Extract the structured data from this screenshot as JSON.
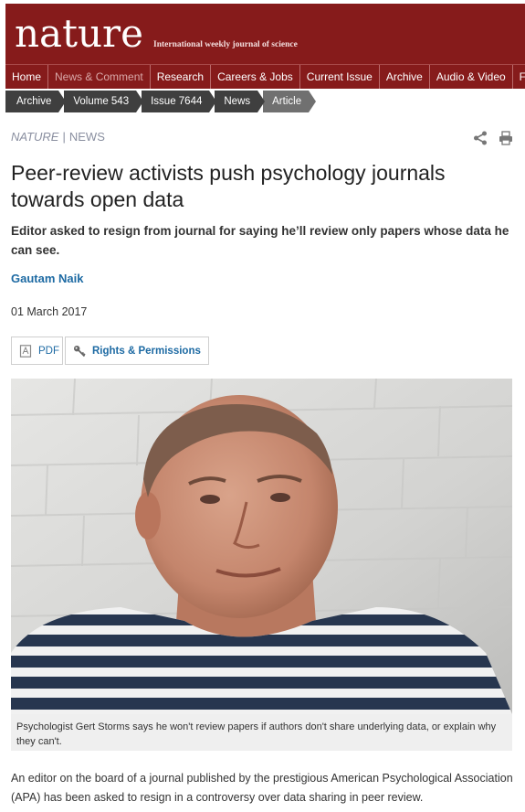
{
  "masthead": {
    "logo": "nature",
    "tagline": "International weekly journal of science"
  },
  "main_nav": {
    "items": [
      {
        "label": "Home",
        "active": false
      },
      {
        "label": "News & Comment",
        "active": true
      },
      {
        "label": "Research",
        "active": false
      },
      {
        "label": "Careers & Jobs",
        "active": false
      },
      {
        "label": "Current Issue",
        "active": false
      },
      {
        "label": "Archive",
        "active": false
      },
      {
        "label": "Audio & Video",
        "active": false
      },
      {
        "label": "For Autho",
        "active": false
      }
    ]
  },
  "breadcrumb": {
    "items": [
      "Archive",
      "Volume 543",
      "Issue 7644",
      "News",
      "Article"
    ]
  },
  "section": {
    "journal": "NATURE",
    "separator": "|",
    "type": "NEWS"
  },
  "article": {
    "headline": "Peer-review activists push psychology journals towards open data",
    "standfirst": "Editor asked to resign from journal for saying he’ll review only papers whose data he can see.",
    "author": "Gautam Naik",
    "date": "01 March 2017",
    "pdf_label": "PDF",
    "rights_label": "Rights & Permissions",
    "caption": "Psychologist Gert Storms says he won't review papers if authors don't share underlying data, or explain why they can't.",
    "body_first": "An editor on the board of a journal published by the prestigious American Psychological Association (APA) has been asked to resign in a controversy over data sharing in peer review."
  },
  "colors": {
    "brand": "#861b1b",
    "breadcrumb": "#3f3f3f",
    "link": "#1d6aa3"
  }
}
